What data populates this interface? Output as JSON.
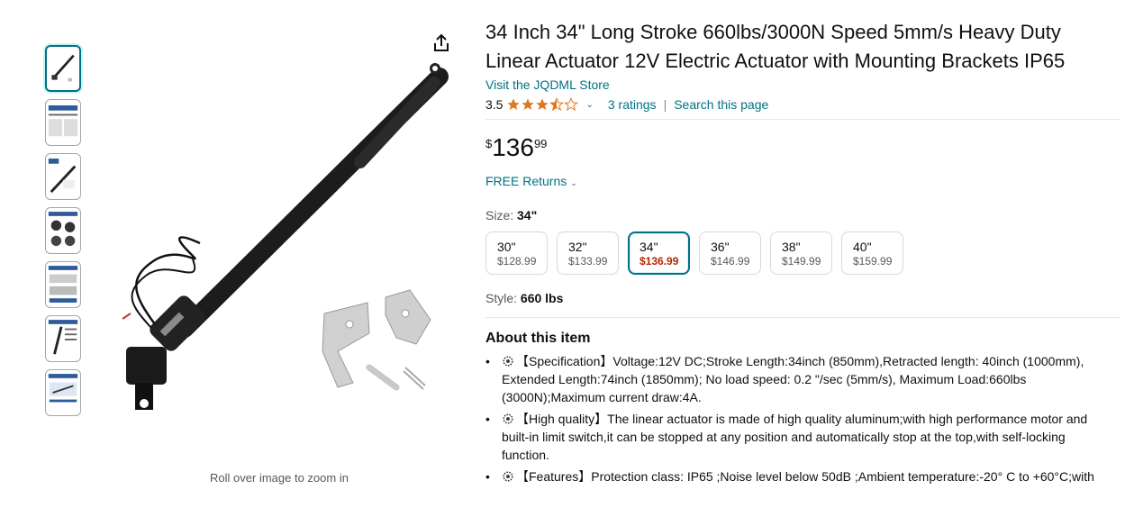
{
  "product": {
    "title": "34 Inch 34\" Long Stroke 660lbs/3000N Speed 5mm/s Heavy Duty Linear Actuator 12V Electric Actuator with Mounting Brackets IP65",
    "store_link": "Visit the JQDML Store",
    "rating": "3.5",
    "ratings_count": "3 ratings",
    "search_link": "Search this page",
    "price": {
      "symbol": "$",
      "whole": "136",
      "fraction": "99"
    },
    "returns": "FREE Returns",
    "size_label": "Size:",
    "size_value": "34\"",
    "sizes": [
      {
        "size": "30\"",
        "price": "$128.99"
      },
      {
        "size": "32\"",
        "price": "$133.99"
      },
      {
        "size": "34\"",
        "price": "$136.99"
      },
      {
        "size": "36\"",
        "price": "$146.99"
      },
      {
        "size": "38\"",
        "price": "$149.99"
      },
      {
        "size": "40\"",
        "price": "$159.99"
      }
    ],
    "selected_size_index": 2,
    "style_label": "Style:",
    "style_value": "660 lbs"
  },
  "gallery": {
    "zoom_hint": "Roll over image to zoom in",
    "thumbnail_count": 7
  },
  "about": {
    "heading": "About this item",
    "bullets": [
      "【Specification】Voltage:12V DC;Stroke Length:34inch (850mm),Retracted length: 40inch (1000mm), Extended Length:74inch (1850mm); No load speed: 0.2 \"/sec (5mm/s), Maximum Load:660lbs (3000N);Maximum current draw:4A.",
      "【High quality】The linear actuator is made of high quality aluminum;with high performance motor and built-in limit switch,it can be stopped at any position and automatically stop at the top,with self-locking function.",
      "【Features】Protection class: IP65 ;Noise level below 50dB ;Ambient temperature:-20° C to +60°C;with"
    ]
  },
  "colors": {
    "link": "#007185",
    "price_red": "#b12704",
    "star": "#de7921",
    "selected_border": "#007185"
  }
}
